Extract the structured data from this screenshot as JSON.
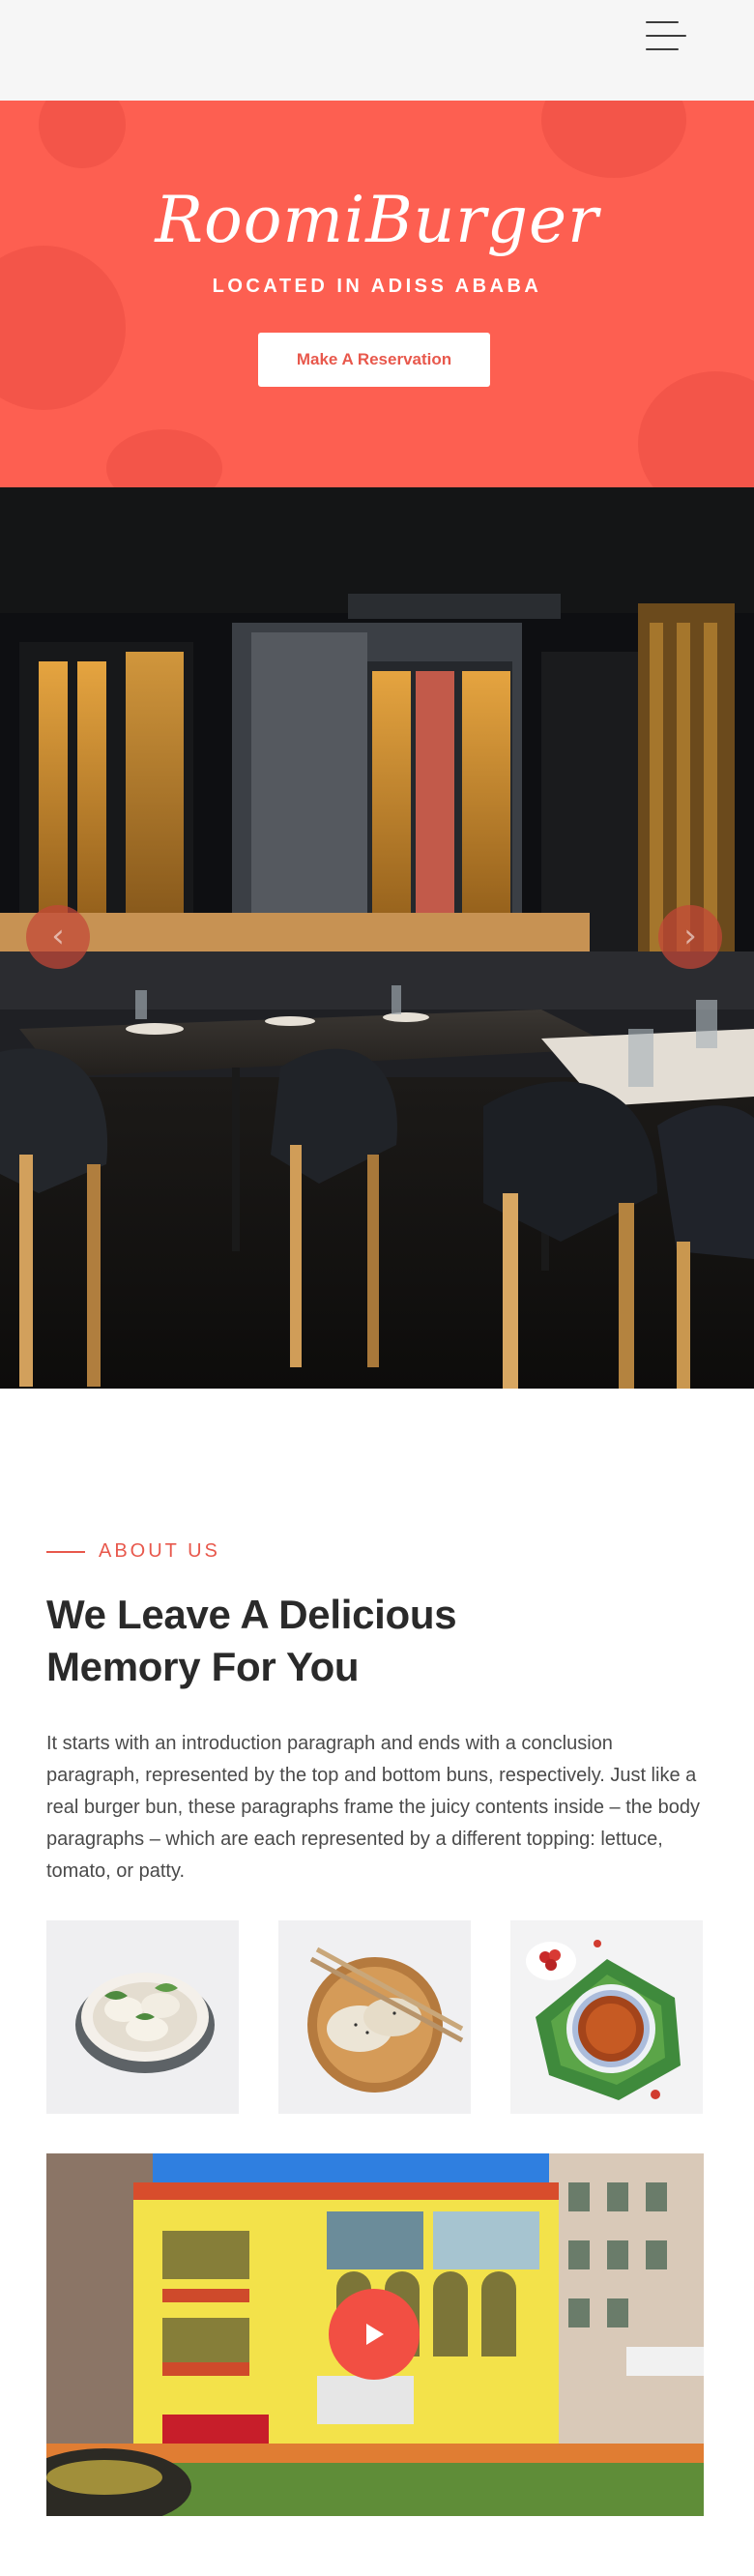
{
  "header": {
    "menu_icon": "hamburger-menu-icon"
  },
  "hero": {
    "brand": "RoomiBurger",
    "location": "LOCATED IN ADISS ABABA",
    "reserve_label": "Make A Reservation",
    "accent_color": "#fd5f51"
  },
  "slider": {
    "prev_icon": "chevron-left-icon",
    "next_icon": "chevron-right-icon",
    "prev_glyph": "‹",
    "next_glyph": "›"
  },
  "about": {
    "eyebrow": "ABOUT US",
    "title": "We Leave A Delicious Memory For You",
    "body": "It starts with an introduction paragraph and ends with a conclusion paragraph, represented by the top and bottom buns, respectively. Just like a real burger bun, these paragraphs frame the juicy contents inside – the body paragraphs – which are each represented by a different topping: lettuce, tomato, or patty."
  },
  "gallery": {
    "items": [
      "dumplings-bowl-photo",
      "dumplings-plate-photo",
      "tea-cup-photo"
    ]
  },
  "video": {
    "play_icon": "play-icon"
  }
}
